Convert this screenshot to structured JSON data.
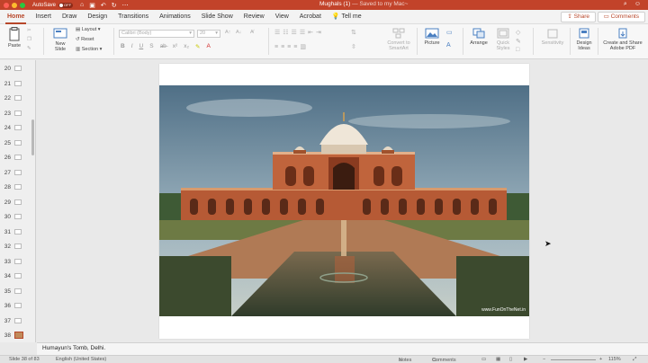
{
  "titlebar": {
    "autosave_label": "AutoSave",
    "autosave_state": "OFF",
    "doc_name": "Mughals (1)",
    "doc_status": "— Saved to my Mac~",
    "colors": {
      "bar": "#c2432a",
      "accent": "#b7472a"
    }
  },
  "tabs": [
    "Home",
    "Insert",
    "Draw",
    "Design",
    "Transitions",
    "Animations",
    "Slide Show",
    "Review",
    "View",
    "Acrobat"
  ],
  "tell_me": "Tell me",
  "share_label": "Share",
  "comments_label": "Comments",
  "ribbon": {
    "paste": "Paste",
    "new_slide": "New Slide",
    "layout": "Layout",
    "reset": "Reset",
    "section": "Section",
    "font_name": "Calibri (Body)",
    "font_size": "20",
    "convert_smartart": "Convert to SmartArt",
    "picture": "Picture",
    "arrange": "Arrange",
    "quick_styles": "Quick Styles",
    "sensitivity": "Sensitivity",
    "design_ideas": "Design Ideas",
    "create_share_pdf": "Create and Share Adobe PDF"
  },
  "thumbnails": [
    "20",
    "21",
    "22",
    "23",
    "24",
    "25",
    "26",
    "27",
    "28",
    "29",
    "30",
    "31",
    "32",
    "33",
    "34",
    "35",
    "36",
    "37",
    "38",
    "39"
  ],
  "selected_thumbnail": "38",
  "slide": {
    "watermark": "www.FunOnTheNet.in"
  },
  "notes_text": "Humayun's Tomb, Delhi.",
  "status": {
    "slide_info": "Slide 38 of 83",
    "language": "English (United States)",
    "notes": "Notes",
    "comments": "Comments",
    "zoom": "115%"
  }
}
